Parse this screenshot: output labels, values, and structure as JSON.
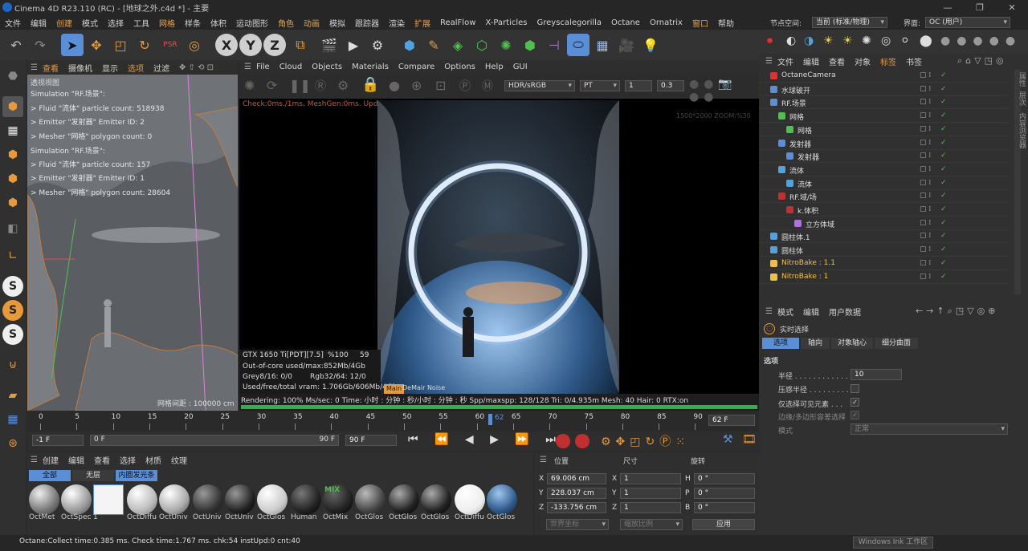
{
  "window": {
    "title": "Cinema 4D R23.110 (RC) - [地球之外.c4d *] - 主要",
    "min": "—",
    "max": "❐",
    "close": "✕"
  },
  "menu": [
    "文件",
    "编辑",
    "创建",
    "模式",
    "选择",
    "工具",
    "网格",
    "样条",
    "体积",
    "运动图形",
    "角色",
    "动画",
    "模拟",
    "跟踪器",
    "渲染",
    "扩展",
    "RealFlow",
    "X-Particles",
    "Greyscalegorilla",
    "Octane",
    "Ornatrix",
    "窗口",
    "帮助"
  ],
  "layout": {
    "node_space_label": "节点空间:",
    "node_space_value": "当前 (标准/物理)",
    "interface_label": "界面:",
    "interface_value": "OC (用户)"
  },
  "viewport": {
    "menu": [
      "查看",
      "摄像机",
      "显示",
      "选项",
      "过滤",
      "面板"
    ],
    "name": "透视视图",
    "overlay": [
      "Simulation \"RF.场景\":",
      "  > Fluid \"流体\" particle count: 518938",
      "  > Emitter \"发射器\" Emitter ID: 2",
      "  > Mesher \"网格\" polygon count: 0",
      "Simulation \"RF.场景\":",
      "  > Fluid \"流体\" particle count: 157",
      "  > Emitter \"发射器\" Emitter ID: 1",
      "  > Mesher \"网格\" polygon count: 28604"
    ],
    "grid_spacing": "网格间距 : 100000 cm"
  },
  "renderview": {
    "menu": [
      "File",
      "Cloud",
      "Objects",
      "Materials",
      "Compare",
      "Options",
      "Help",
      "GUI"
    ],
    "colorspace": "HDR/sRGB",
    "mode": "PT",
    "value1": "1",
    "value2": "0.3",
    "status_line": "Check:0ms./1ms. MeshGen:0ms. Update[G]:0ms. Nodes:57 Movable:40 Mot:2000 3 Scatter:13",
    "size_info": "1500*2000 ZOOM:%30",
    "stats": [
      {
        "a": "GTX 1650 Ti[PDT][7.5]",
        "b": "%100",
        "c": "59"
      },
      {
        "a": "Out-of-core used/max:852Mb/4Gb",
        "b": "",
        "c": ""
      },
      {
        "a": "Grey8/16: 0/0",
        "b": "Rgb32/64: 12/0",
        "c": ""
      },
      {
        "a": "Used/free/total vram: 1.706Gb/606Mb/4Gb",
        "b": "",
        "c": ""
      }
    ],
    "main_tag": "Main",
    "noise_tag": "DeMair Noise",
    "render_status": "Rendering: 100%    Ms/sec: 0    Time: 小时 : 分钟 : 秒/小时 : 分钟 : 秒    Spp/maxspp: 128/128    Tri: 0/4.935m  Mesh: 40    Hair: 0    RTX:on"
  },
  "timeline": {
    "ticks": [
      "0",
      "5",
      "10",
      "15",
      "20",
      "25",
      "30",
      "35",
      "40",
      "45",
      "50",
      "55",
      "60",
      "65",
      "70",
      "75",
      "80",
      "85",
      "90"
    ],
    "current": "62",
    "end_field": "62 F",
    "start_field": "-1 F",
    "min_field": "0 F",
    "max_field": "90 F",
    "out_field": "90 F"
  },
  "materials": {
    "menu": [
      "创建",
      "编辑",
      "查看",
      "选择",
      "材质",
      "纹理"
    ],
    "filters": [
      "全部",
      "无层",
      "内圈发光条"
    ],
    "items": [
      "OctMet",
      "OctSpec",
      "1",
      "OctDiffu",
      "OctUniv",
      "OctUniv",
      "OctUniv",
      "OctGlos",
      "Human",
      "OctMix",
      "OctGlos",
      "OctGlos",
      "OctGlos",
      "OctDiffu",
      "OctGlos"
    ]
  },
  "coords": {
    "headers": [
      "位置",
      "尺寸",
      "旋转"
    ],
    "rows": [
      {
        "axis": "X",
        "pos": "69.006 cm",
        "saxis": "X",
        "size": "1",
        "raxis": "H",
        "rot": "0 °"
      },
      {
        "axis": "Y",
        "pos": "228.037 cm",
        "saxis": "Y",
        "size": "1",
        "raxis": "P",
        "rot": "0 °"
      },
      {
        "axis": "Z",
        "pos": "-133.756 cm",
        "saxis": "Z",
        "size": "1",
        "raxis": "B",
        "rot": "0 °"
      }
    ],
    "space": "世界坐标",
    "scale": "缩放比例",
    "apply": "应用"
  },
  "status": {
    "text": "Octane:Collect time:0.385 ms.  Check time:1.767 ms.  chk:54  instUpd:0  cnt:40",
    "ink": "Windows Ink 工作区"
  },
  "objects": {
    "menu": [
      "文件",
      "编辑",
      "查看",
      "对象",
      "标签",
      "书签"
    ],
    "items": [
      {
        "name": "OctaneCamera",
        "indent": 0,
        "color": "#dddddd"
      },
      {
        "name": "水球破开",
        "indent": 0,
        "color": "#dddddd"
      },
      {
        "name": "RF.场景",
        "indent": 0,
        "color": "#dddddd"
      },
      {
        "name": "网格",
        "indent": 1,
        "color": "#dddddd"
      },
      {
        "name": "网格",
        "indent": 2,
        "color": "#dddddd"
      },
      {
        "name": "发射器",
        "indent": 1,
        "color": "#dddddd"
      },
      {
        "name": "发射器",
        "indent": 2,
        "color": "#dddddd"
      },
      {
        "name": "流体",
        "indent": 1,
        "color": "#dddddd"
      },
      {
        "name": "流体",
        "indent": 2,
        "color": "#dddddd"
      },
      {
        "name": "RF.域/场",
        "indent": 1,
        "color": "#dddddd"
      },
      {
        "name": "k.体积",
        "indent": 2,
        "color": "#dddddd"
      },
      {
        "name": "立方体域",
        "indent": 3,
        "color": "#dddddd"
      },
      {
        "name": "圆柱体.1",
        "indent": 0,
        "color": "#dddddd"
      },
      {
        "name": "圆柱体",
        "indent": 0,
        "color": "#dddddd"
      },
      {
        "name": "NitroBake : 1.1",
        "indent": 0,
        "color": "#f0c040"
      },
      {
        "name": "NitroBake : 1",
        "indent": 0,
        "color": "#f0c040"
      }
    ]
  },
  "side_tabs": [
    "属性",
    "层次",
    "内容浏览器"
  ],
  "attributes": {
    "menu": [
      "模式",
      "编辑",
      "用户数据"
    ],
    "tool": "实时选择",
    "tabs": [
      "选项",
      "轴向",
      "对象轴心",
      "细分曲面"
    ],
    "section": "选项",
    "fields": [
      {
        "label": "半径 . . . . . . . . . . . . .",
        "value": "10"
      },
      {
        "label": "压感半径 . . . . . . . . .",
        "value": ""
      },
      {
        "label": "仅选择可见元素 . . .",
        "value": "✓"
      },
      {
        "label": "边缘/多边形容差选择",
        "value": "✓"
      },
      {
        "label": "模式",
        "value": "正常"
      }
    ]
  },
  "colors": {
    "accent_blue": "#5a8fd8",
    "octane_orange": "#e27b1c",
    "green": "#4fc04f"
  }
}
